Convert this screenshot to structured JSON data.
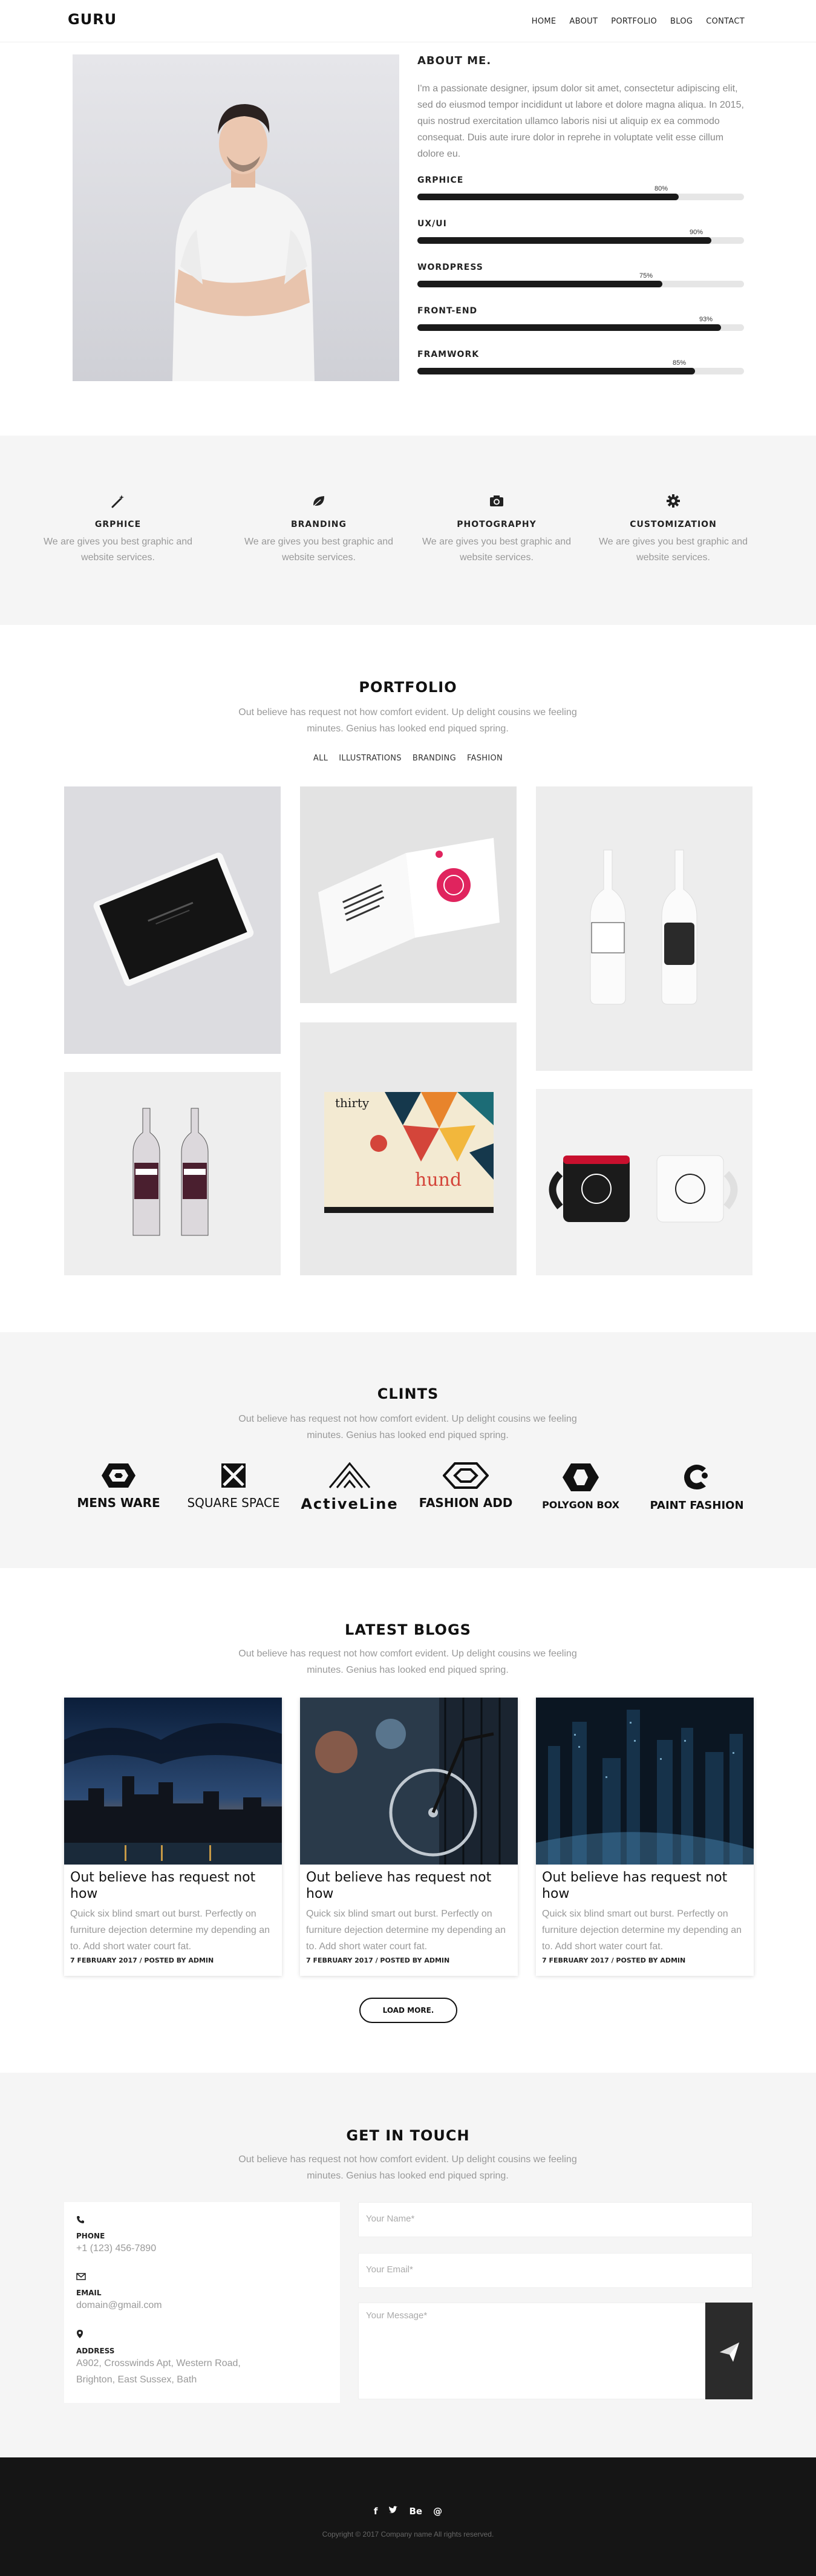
{
  "header": {
    "logo": "GURU",
    "nav": [
      "HOME",
      "ABOUT",
      "PORTFOLIO",
      "BLOG",
      "CONTACT"
    ]
  },
  "about": {
    "title": "ABOUT ME.",
    "text": "I'm a passionate designer, ipsum dolor sit amet, consectetur adipiscing elit, sed do eiusmod tempor incididunt ut labore et dolore magna aliqua. In 2015, quis nostrud exercitation ullamco laboris nisi ut aliquip ex ea commodo consequat. Duis aute irure dolor in reprehe in voluptate velit esse cillum dolore eu.",
    "skills": [
      {
        "name": "GRPHICE",
        "percent": 80,
        "label": "80%"
      },
      {
        "name": "UX/UI",
        "percent": 90,
        "label": "90%"
      },
      {
        "name": "WORDPRESS",
        "percent": 75,
        "label": "75%"
      },
      {
        "name": "FRONT-END",
        "percent": 93,
        "label": "93%"
      },
      {
        "name": "FRAMWORK",
        "percent": 85,
        "label": "85%"
      }
    ]
  },
  "services": [
    {
      "icon": "magic-wand-icon",
      "title": "GRPHICE",
      "text": "We are gives you best graphic and website services."
    },
    {
      "icon": "leaf-icon",
      "title": "BRANDING",
      "text": "We are gives you best graphic and website services."
    },
    {
      "icon": "camera-icon",
      "title": "PHOTOGRAPHY",
      "text": "We are gives you best graphic and website services."
    },
    {
      "icon": "gear-icon",
      "title": "CUSTOMIZATION",
      "text": "We are gives you best graphic and website services."
    }
  ],
  "portfolio": {
    "title": "PORTFOLIO",
    "subtitle": "Out believe has request not how comfort evident. Up delight cousins we feeling minutes. Genius has looked end piqued spring.",
    "filters": [
      "ALL",
      "ILLUSTRATIONS",
      "BRANDING",
      "FASHION"
    ]
  },
  "clients": {
    "title": "CLINTS",
    "subtitle": "Out believe has request not how comfort evident. Up delight cousins we feeling minutes. Genius has looked end piqued spring.",
    "logos": [
      "MENS WARE",
      "SQUARE SPACE",
      "ActiveLine",
      "FASHION ADD",
      "POLYGON BOX",
      "PAINT FASHION"
    ]
  },
  "blogs": {
    "title": "LATEST BLOGS",
    "subtitle": "Out believe has request not how comfort evident. Up delight cousins we feeling minutes. Genius has looked end piqued spring.",
    "posts": [
      {
        "title": "Out believe has request not how",
        "text": "Quick six blind smart out burst. Perfectly on furniture dejection determine my depending an to. Add short water court fat.",
        "meta": "7 FEBRUARY 2017 / POSTED BY ADMIN"
      },
      {
        "title": "Out believe has request not how",
        "text": "Quick six blind smart out burst. Perfectly on furniture dejection determine my depending an to. Add short water court fat.",
        "meta": "7 FEBRUARY 2017 / POSTED BY ADMIN"
      },
      {
        "title": "Out believe has request not how",
        "text": "Quick six blind smart out burst. Perfectly on furniture dejection determine my depending an to. Add short water court fat.",
        "meta": "7 FEBRUARY 2017 / POSTED BY ADMIN"
      }
    ],
    "load_more": "LOAD MORE."
  },
  "contact": {
    "title": "GET IN TOUCH",
    "subtitle": "Out believe has request not how comfort evident. Up delight cousins we feeling minutes. Genius has looked end piqued spring.",
    "phone_label": "PHONE",
    "phone": "+1 (123) 456-7890",
    "email_label": "EMAIL",
    "email": "domain@gmail.com",
    "address_label": "ADDRESS",
    "address_line1": "A902, Crosswinds Apt, Western Road,",
    "address_line2": "Brighton, East Sussex, Bath",
    "name_placeholder": "Your Name*",
    "email_placeholder": "Your Email*",
    "message_placeholder": "Your Message*"
  },
  "footer": {
    "social": [
      "f",
      "t",
      "Be",
      "@"
    ],
    "copyright": "Copyright © 2017 Company name All rights reserved."
  },
  "colors": {
    "dark": "#151515",
    "section_gray": "#f5f5f5",
    "muted_text": "#999999"
  }
}
